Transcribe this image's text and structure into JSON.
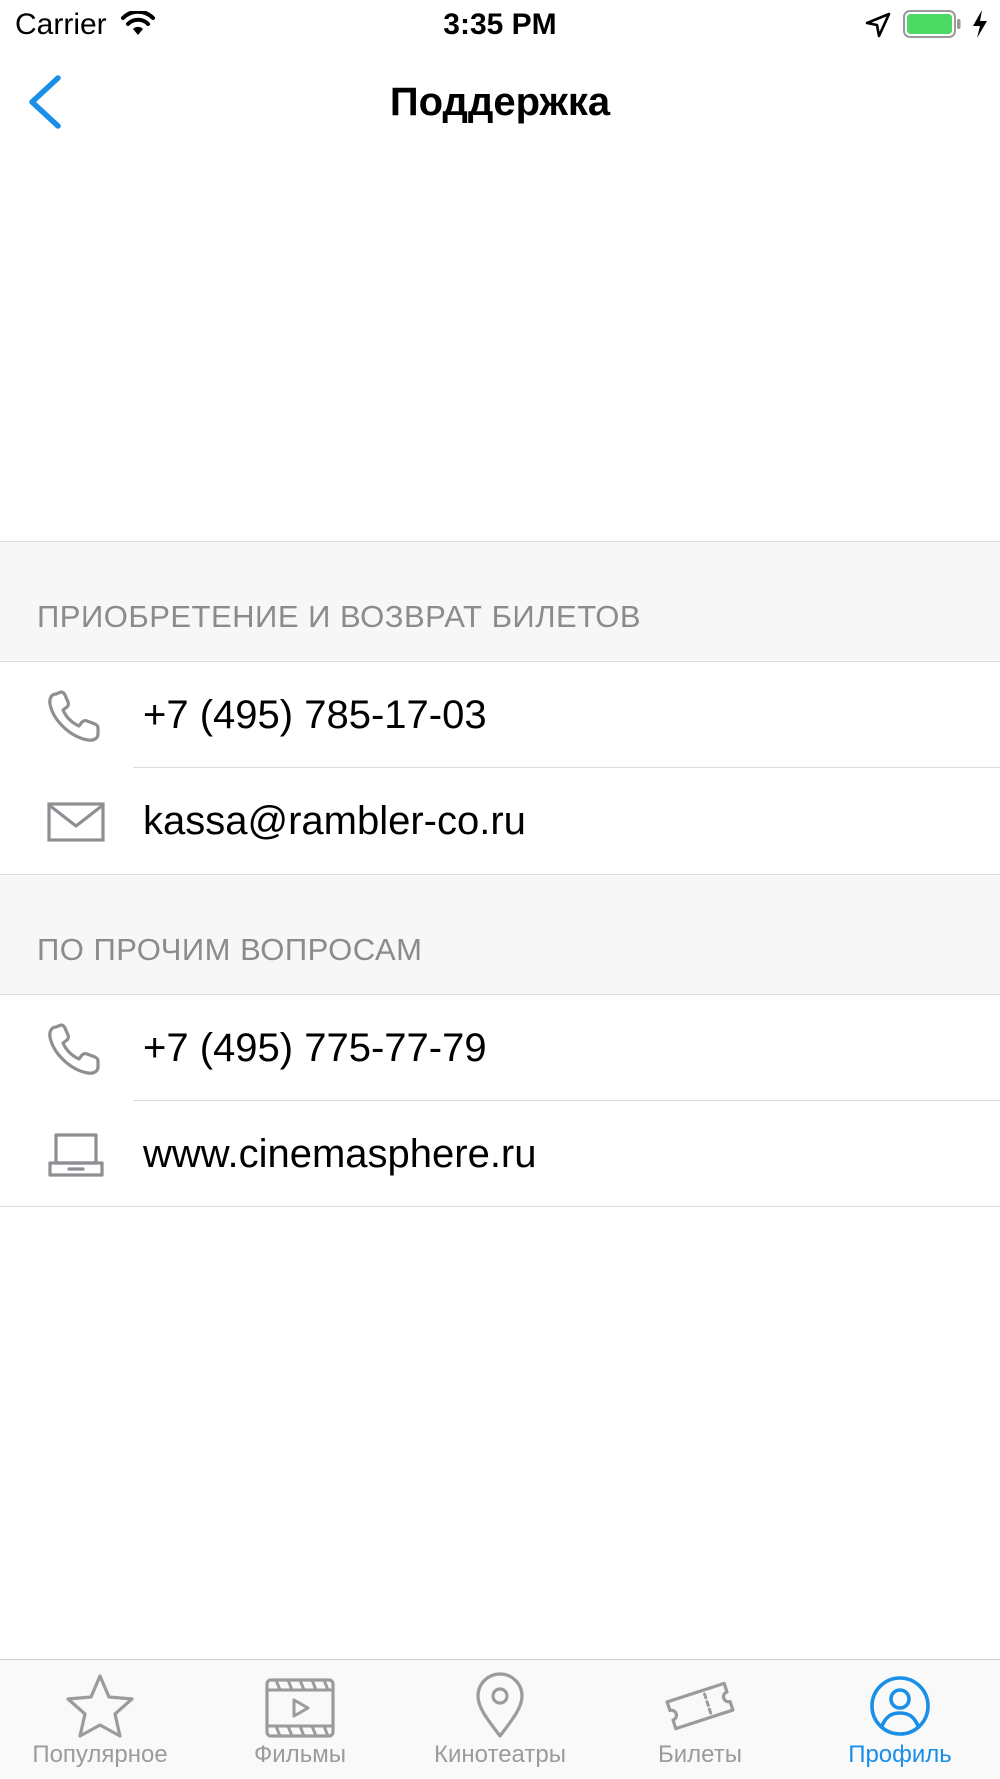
{
  "status_bar": {
    "carrier": "Carrier",
    "time": "3:35 PM",
    "battery_color": "#4cd964"
  },
  "nav": {
    "title": "Поддержка",
    "back_icon": "chevron-left-icon",
    "accent_color": "#1a8fe8"
  },
  "sections": [
    {
      "header": "ПРИОБРЕТЕНИЕ И ВОЗВРАТ БИЛЕТОВ",
      "rows": [
        {
          "icon": "phone-icon",
          "label": "+7 (495) 785-17-03"
        },
        {
          "icon": "mail-icon",
          "label": "kassa@rambler-co.ru"
        }
      ]
    },
    {
      "header": "ПО ПРОЧИМ ВОПРОСАМ",
      "rows": [
        {
          "icon": "phone-icon",
          "label": "+7 (495) 775-77-79"
        },
        {
          "icon": "laptop-icon",
          "label": "www.cinemasphere.ru"
        }
      ]
    }
  ],
  "tab_bar": {
    "tabs": [
      {
        "label": "Популярное",
        "icon": "star-icon",
        "active": false
      },
      {
        "label": "Фильмы",
        "icon": "film-icon",
        "active": false
      },
      {
        "label": "Кинотеатры",
        "icon": "location-pin-icon",
        "active": false
      },
      {
        "label": "Билеты",
        "icon": "ticket-icon",
        "active": false
      },
      {
        "label": "Профиль",
        "icon": "profile-icon",
        "active": true
      }
    ],
    "active_color": "#1a8fe8",
    "inactive_color": "#9b9b9b"
  }
}
